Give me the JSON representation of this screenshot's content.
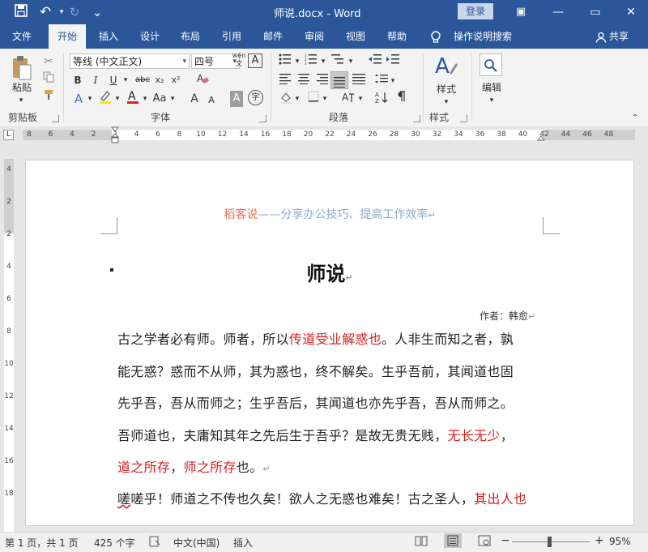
{
  "window": {
    "title": "师说.docx  -  Word",
    "login_label": "登录",
    "controls": {
      "minimize": "—",
      "restore": "▭",
      "close": "✕"
    }
  },
  "quick_access": {
    "save": "💾",
    "undo": "↶",
    "redo": "↻",
    "customize": "⌄"
  },
  "tabs": [
    {
      "label": "文件"
    },
    {
      "label": "开始"
    },
    {
      "label": "插入"
    },
    {
      "label": "设计"
    },
    {
      "label": "布局"
    },
    {
      "label": "引用"
    },
    {
      "label": "邮件"
    },
    {
      "label": "审阅"
    },
    {
      "label": "视图"
    },
    {
      "label": "帮助"
    }
  ],
  "active_tab": "开始",
  "tell_me": "操作说明搜索",
  "share_label": "共享",
  "ribbon": {
    "clipboard": {
      "label": "剪贴板",
      "paste_label": "粘贴"
    },
    "font": {
      "label": "字体",
      "font_name": "等线 (中文正文)",
      "font_size": "四号",
      "phonetic": "wén 文",
      "bold": "B",
      "italic": "I",
      "underline": "U",
      "strike": "abc",
      "subscript": "x₂",
      "superscript": "x²",
      "grow": "A",
      "shrink": "A",
      "case": "Aa",
      "char_shade": "A",
      "enclose": "字"
    },
    "paragraph": {
      "label": "段落"
    },
    "styles": {
      "label": "样式",
      "button_label": "样式"
    },
    "editing": {
      "button_label": "编辑"
    }
  },
  "ruler": {
    "h_ticks": [
      "8",
      "6",
      "4",
      "2",
      "2",
      "4",
      "6",
      "8",
      "10",
      "12",
      "14",
      "16",
      "18",
      "20",
      "22",
      "24",
      "26",
      "28",
      "30",
      "32",
      "34",
      "36",
      "38",
      "40",
      "42",
      "44",
      "46",
      "48"
    ],
    "v_ticks": [
      "4",
      "2",
      "2",
      "4",
      "6",
      "8",
      "10",
      "12",
      "14",
      "16",
      "18"
    ]
  },
  "document": {
    "header_prefix": "稻客说",
    "header_rest": "——分享办公技巧、提高工作效率",
    "title": "师说",
    "author": "作者：韩愈",
    "p1_l1_a": "古之学者必有师。师者，所以",
    "p1_l1_red": "传道受业解惑也",
    "p1_l1_b": "。人非生而知之者，孰",
    "p1_l2": "能无惑？惑而不从师，其为惑也，终不解矣。生乎吾前，其闻道也固",
    "p1_l3": "先乎吾，吾从而师之；生乎吾后，其闻道也亦先乎吾，吾从而师之。",
    "p1_l4_a": "吾师道也，夫庸知其年之先后生于吾乎？是故无贵无贱，",
    "p1_l4_red": "无长无少",
    "p1_l4_b": "，",
    "p1_l5_red1": "道之所存",
    "p1_l5_a": "，",
    "p1_l5_red2": "师之所存",
    "p1_l5_b": "也。",
    "p2_l1_a": "嗟乎！师道之不传也久矣！欲人之无惑也难矣！古之圣人，",
    "p2_l1_red": "其出人也"
  },
  "status": {
    "page": "第 1 页，共 1 页",
    "words": "425 个字",
    "language": "中文(中国)",
    "mode": "插入",
    "zoom": "95%",
    "zoom_minus": "−",
    "zoom_plus": "+"
  },
  "colors": {
    "brand": "#2b579a",
    "red_text": "#d81e1e",
    "header_accent": "#e0715b",
    "header_text": "#8fa9c9"
  }
}
